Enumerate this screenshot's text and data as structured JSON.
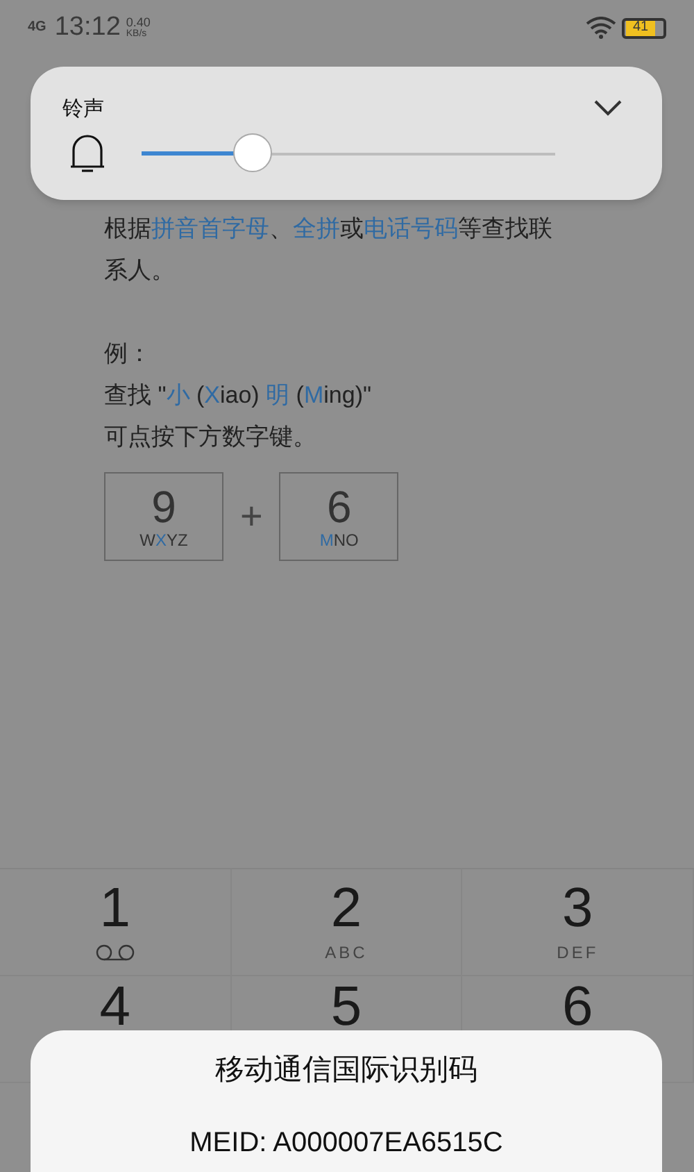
{
  "status_bar": {
    "network": "4G",
    "time": "13:12",
    "speed_value": "0.40",
    "speed_unit": "KB/s",
    "battery": "41"
  },
  "volume_panel": {
    "label": "铃声",
    "level": 0.27
  },
  "help": {
    "paragraphs": [
      [
        {
          "text": "根据",
          "highlight": false
        },
        {
          "text": "拼音首字母",
          "highlight": true
        },
        {
          "text": "、",
          "highlight": false
        },
        {
          "text": "全拼",
          "highlight": true
        },
        {
          "text": "或",
          "highlight": false
        },
        {
          "text": "电话号码",
          "highlight": true
        },
        {
          "text": "等查找联系人。",
          "highlight": false
        }
      ],
      [
        {
          "text": "例：",
          "highlight": false
        }
      ],
      [
        {
          "text": "查找 \"",
          "highlight": false
        },
        {
          "text": "小",
          "highlight": true
        },
        {
          "text": " (",
          "highlight": false
        },
        {
          "text": "X",
          "highlight": true
        },
        {
          "text": "iao) ",
          "highlight": false
        },
        {
          "text": "明",
          "highlight": true
        },
        {
          "text": " (",
          "highlight": false
        },
        {
          "text": "M",
          "highlight": true
        },
        {
          "text": "ing)\"",
          "highlight": false
        }
      ],
      [
        {
          "text": "可点按下方数字键。",
          "highlight": false
        }
      ]
    ],
    "example_keys": [
      {
        "digit": "9",
        "letters": [
          {
            "text": "W",
            "highlight": false
          },
          {
            "text": "X",
            "highlight": true
          },
          {
            "text": "YZ",
            "highlight": false
          }
        ]
      },
      {
        "digit": "6",
        "letters": [
          {
            "text": "M",
            "highlight": true
          },
          {
            "text": "NO",
            "highlight": false
          }
        ]
      }
    ],
    "plus": "+"
  },
  "keypad": [
    {
      "digit": "1",
      "kind": "voicemail"
    },
    {
      "digit": "2",
      "kind": "letters",
      "letters": "ABC"
    },
    {
      "digit": "3",
      "kind": "letters",
      "letters": "DEF"
    },
    {
      "digit": "4",
      "kind": "plain"
    },
    {
      "digit": "5",
      "kind": "plain"
    },
    {
      "digit": "6",
      "kind": "plain"
    }
  ],
  "dialog": {
    "title": "移动通信国际识别码",
    "body": "MEID: A000007EA6515C"
  }
}
